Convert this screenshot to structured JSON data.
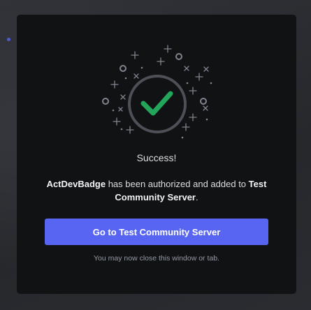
{
  "colors": {
    "page_background": "#2b2d31",
    "modal_background": "#111214",
    "accent": "#5865f2",
    "success_check": "#23a55a",
    "ring": "#4e5058",
    "sparkle": "#80848e"
  },
  "modal": {
    "icon": "success-check-icon",
    "title": "Success!",
    "message": {
      "app_name": "ActDevBadge",
      "middle_text": " has been authorized and added to ",
      "server_name": "Test Community Server",
      "end_text": "."
    },
    "primary_button_label": "Go to Test Community Server",
    "hint": "You may now close this window or tab."
  }
}
